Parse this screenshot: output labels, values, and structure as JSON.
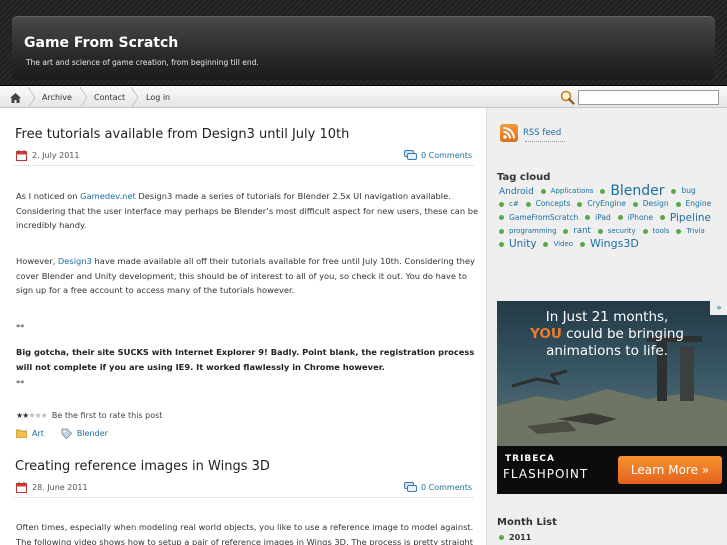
{
  "header": {
    "title": "Game From Scratch",
    "tagline": "The art and science of game creation, from beginning till end."
  },
  "nav": {
    "items": [
      "Archive",
      "Contact",
      "Log in"
    ],
    "search_value": ""
  },
  "posts": [
    {
      "title": "Free tutorials available from Design3 until July 10th",
      "date": "2. July 2011",
      "comments": "0 Comments",
      "p1_pre": "As I noticed on ",
      "p1_link": "Gamedev.net",
      "p1_post": " Design3 made a series of tutorials for Blender 2.5x UI navigation available.  Considering that the user interface may perhaps be Blender’s most difficult aspect for new users, these can be incredibly handy.",
      "p2_pre": "However, ",
      "p2_link": "Design3",
      "p2_post": " have made available all off their tutorials available for free until July 10th.  Considering they cover Blender and Unity development, this should be of interest to all of you, so check it out.  You do have to sign up for a free account to access many of the tutorials however.",
      "asterisks1": "**",
      "p3": "Big gotcha, their site SUCKS with Internet Explorer 9!  Badly.  Point blank, the registration process will not complete if you are using IE9. It worked flawlessly in Chrome however.",
      "asterisks2": "**",
      "rating_text": "Be the first to rate this post",
      "rating_value": 2,
      "rating_max": 5,
      "categories": [
        "Art",
        "Blender"
      ]
    },
    {
      "title": "Creating reference images in Wings 3D",
      "date": "28. June 2011",
      "comments": "0 Comments",
      "p1": "Often times, especially when modeling real world objects, you like to use a reference image to model against.  The following video shows how to setup a pair of reference images in Wings 3D.  The process is pretty straight"
    }
  ],
  "sidebar": {
    "rss_label": "RSS feed",
    "tag_cloud_title": "Tag cloud",
    "tags": [
      {
        "label": "Android",
        "size": 9
      },
      {
        "label": "Applications",
        "size": 7
      },
      {
        "label": "Blender",
        "size": 14
      },
      {
        "label": "bug",
        "size": 7.5
      },
      {
        "label": "c#",
        "size": 7
      },
      {
        "label": "Concepts",
        "size": 7.5
      },
      {
        "label": "CryEngine",
        "size": 7.5
      },
      {
        "label": "Design",
        "size": 7.5
      },
      {
        "label": "Engine",
        "size": 7.5
      },
      {
        "label": "GameFromScratch",
        "size": 7.5
      },
      {
        "label": "iPad",
        "size": 7.5
      },
      {
        "label": "iPhone",
        "size": 7.5
      },
      {
        "label": "Pipeline",
        "size": 10.5
      },
      {
        "label": "programming",
        "size": 7
      },
      {
        "label": "rant",
        "size": 8.5
      },
      {
        "label": "security",
        "size": 7
      },
      {
        "label": "tools",
        "size": 7
      },
      {
        "label": "Trivia",
        "size": 7
      },
      {
        "label": "Unity",
        "size": 10.5
      },
      {
        "label": "Video",
        "size": 7
      },
      {
        "label": "Wings3D",
        "size": 11
      }
    ],
    "ad": {
      "line1": "In Just 21 months,",
      "line2_highlight": "YOU",
      "line2_rest": " could be bringing",
      "line3": "animations to life.",
      "brand1": "TRIBECA",
      "brand2": "FLASHPOINT",
      "cta": "Learn More »",
      "badge": "»"
    },
    "month_list_title": "Month List",
    "month_items": [
      "2011"
    ]
  },
  "colors": {
    "link": "#1a6fa0",
    "tag_dot": "#5ba84a",
    "ad_cta": "#f07c2a"
  }
}
